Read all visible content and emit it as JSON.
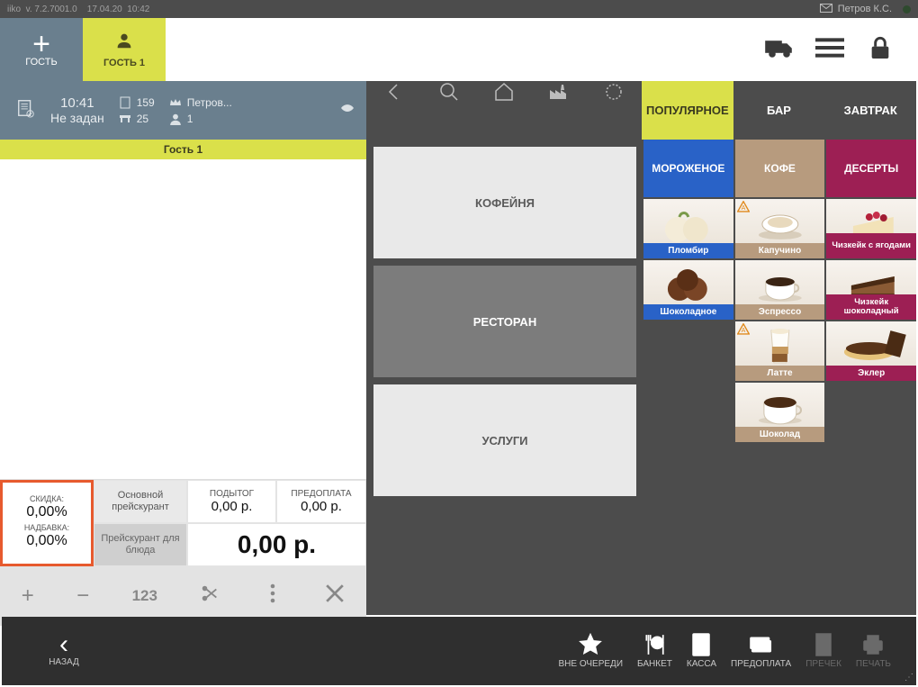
{
  "top": {
    "app": "iiko",
    "ver": "v. 7.2.7001.0",
    "date": "17.04.20",
    "time": "10:42",
    "user": "Петров К.С."
  },
  "tabs": {
    "new": "ГОСТЬ",
    "guest1": "ГОСТЬ 1"
  },
  "info": {
    "time": "10:41",
    "status": "Не задан",
    "bill": "159",
    "table": "25",
    "waiter": "Петров...",
    "pax": "1"
  },
  "guestband": "Гость 1",
  "maincats": {
    "popular": "ПОПУЛЯРНОЕ",
    "bar": "БАР",
    "breakfast": "ЗАВТРАК"
  },
  "bigcats": {
    "cafe": "КОФЕЙНЯ",
    "rest": "РЕСТОРАН",
    "serv": "УСЛУГИ"
  },
  "subheads": {
    "ice": "МОРОЖЕНОЕ",
    "coffee": "КОФЕ",
    "dessert": "ДЕСЕРТЫ"
  },
  "products": {
    "plombir": "Пломбир",
    "cappu": "Капучино",
    "cheeseberry": "Чизкейк с ягодами",
    "choco_ice": "Шоколадное",
    "espresso": "Эспрессо",
    "cheesechoco": "Чизкейк шоколадный",
    "latte": "Латте",
    "eclair": "Эклер",
    "choco": "Шоколад"
  },
  "summary": {
    "discount_lbl": "СКИДКА:",
    "discount": "0,00%",
    "markup_lbl": "НАДБАВКА:",
    "markup": "0,00%",
    "mainpl": "Основной прейскурант",
    "dishpl": "Прейскурант для блюда",
    "subtotal_lbl": "ПОДЫТОГ",
    "subtotal": "0,00 р.",
    "prepay_lbl": "ПРЕДОПЛАТА",
    "prepay": "0,00 р.",
    "total": "0,00 р."
  },
  "editrow": {
    "num": "123"
  },
  "footer": {
    "back": "НАЗАД",
    "queue": "ВНЕ ОЧЕРЕДИ",
    "banquet": "БАНКЕТ",
    "cash": "КАССА",
    "prepay": "ПРЕДОПЛАТА",
    "precheck": "ПРЕЧЕК",
    "print": "ПЕЧАТЬ"
  }
}
